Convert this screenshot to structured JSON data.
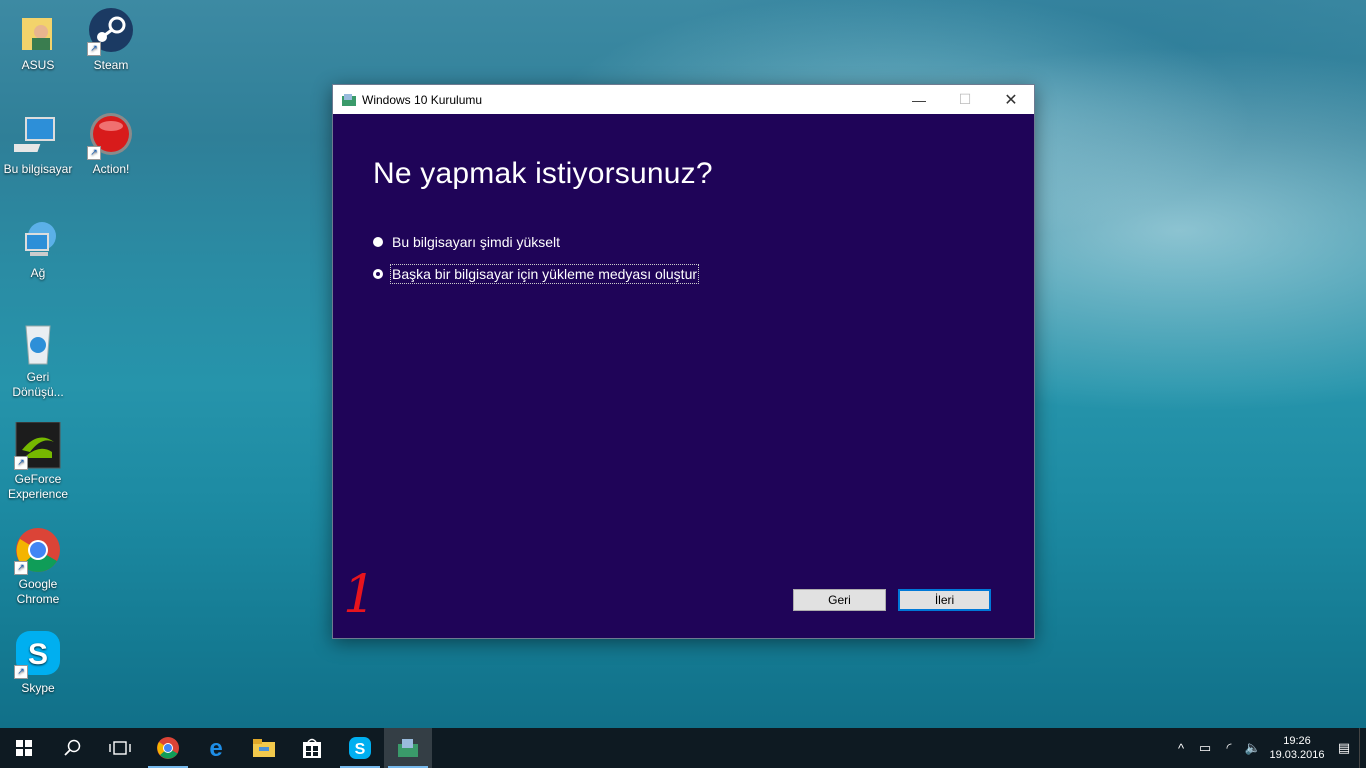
{
  "desktop": {
    "icons": [
      {
        "label": "ASUS",
        "icon": "user-folder-icon"
      },
      {
        "label": "Steam",
        "icon": "steam-icon"
      },
      {
        "label": "Bu bilgisayar",
        "icon": "computer-icon"
      },
      {
        "label": "Action!",
        "icon": "record-icon"
      },
      {
        "label": "Ağ",
        "icon": "network-icon"
      },
      {
        "label": "Geri Dönüşü...",
        "icon": "recycle-bin-icon"
      },
      {
        "label": "GeForce Experience",
        "icon": "nvidia-icon"
      },
      {
        "label": "Google Chrome",
        "icon": "chrome-icon"
      },
      {
        "label": "Skype",
        "icon": "skype-icon"
      }
    ]
  },
  "window": {
    "title": "Windows 10 Kurulumu",
    "heading": "Ne yapmak istiyorsunuz?",
    "options": [
      {
        "label": "Bu bilgisayarı şimdi yükselt",
        "selected": false
      },
      {
        "label": "Başka bir bilgisayar için yükleme medyası oluştur",
        "selected": true
      }
    ],
    "back_label": "Geri",
    "next_label": "İleri",
    "annotation": "1"
  },
  "taskbar": {
    "items": [
      "start-icon",
      "search-icon",
      "task-view-icon",
      "chrome-icon",
      "edge-icon",
      "file-explorer-icon",
      "store-icon",
      "skype-icon",
      "windows-setup-icon"
    ],
    "clock_time": "19:26",
    "clock_date": "19.03.2016"
  },
  "colors": {
    "window_bg": "#1f0458",
    "taskbar_bg": "#0e1a22",
    "accent": "#0078d7"
  }
}
